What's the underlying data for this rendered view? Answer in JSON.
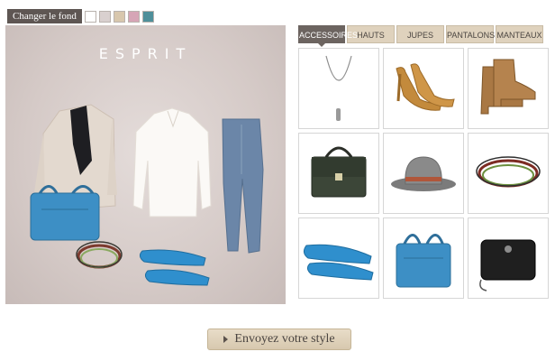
{
  "background_switcher": {
    "label": "Changer le fond",
    "swatches": [
      "#ffffff",
      "#d9d0cf",
      "#d8c7ad",
      "#d6a5b6",
      "#4e8f9a"
    ]
  },
  "canvas": {
    "brand": "ESPRIT",
    "items": [
      {
        "name": "blazer-icon",
        "label": "Beige blazer with black lapels"
      },
      {
        "name": "blouse-icon",
        "label": "White blouse"
      },
      {
        "name": "jeans-icon",
        "label": "Slim blue jeans"
      },
      {
        "name": "blue-handbag-icon",
        "label": "Blue leather handbag"
      },
      {
        "name": "bracelet-icon",
        "label": "Wrap bracelet"
      },
      {
        "name": "blue-flats-icon",
        "label": "Blue ballerina flats"
      }
    ]
  },
  "tabs": [
    {
      "label": "ACCESSOIRES",
      "active": true
    },
    {
      "label": "HAUTS",
      "active": false
    },
    {
      "label": "JUPES",
      "active": false
    },
    {
      "label": "PANTALONS",
      "active": false
    },
    {
      "label": "MANTEAUX",
      "active": false
    }
  ],
  "products": [
    {
      "name": "necklace-icon"
    },
    {
      "name": "tan-pumps-icon"
    },
    {
      "name": "ankle-boots-icon"
    },
    {
      "name": "green-satchel-icon"
    },
    {
      "name": "grey-fedora-icon"
    },
    {
      "name": "wrap-bracelet-icon"
    },
    {
      "name": "blue-flats-icon"
    },
    {
      "name": "blue-handbag-icon"
    },
    {
      "name": "black-clutch-icon"
    }
  ],
  "colors": {
    "accent_tab": "#6c6460",
    "tab_bg": "#dfd2bd",
    "blue_item": "#3d8fc5"
  },
  "send_button": {
    "label": "Envoyez votre style"
  }
}
